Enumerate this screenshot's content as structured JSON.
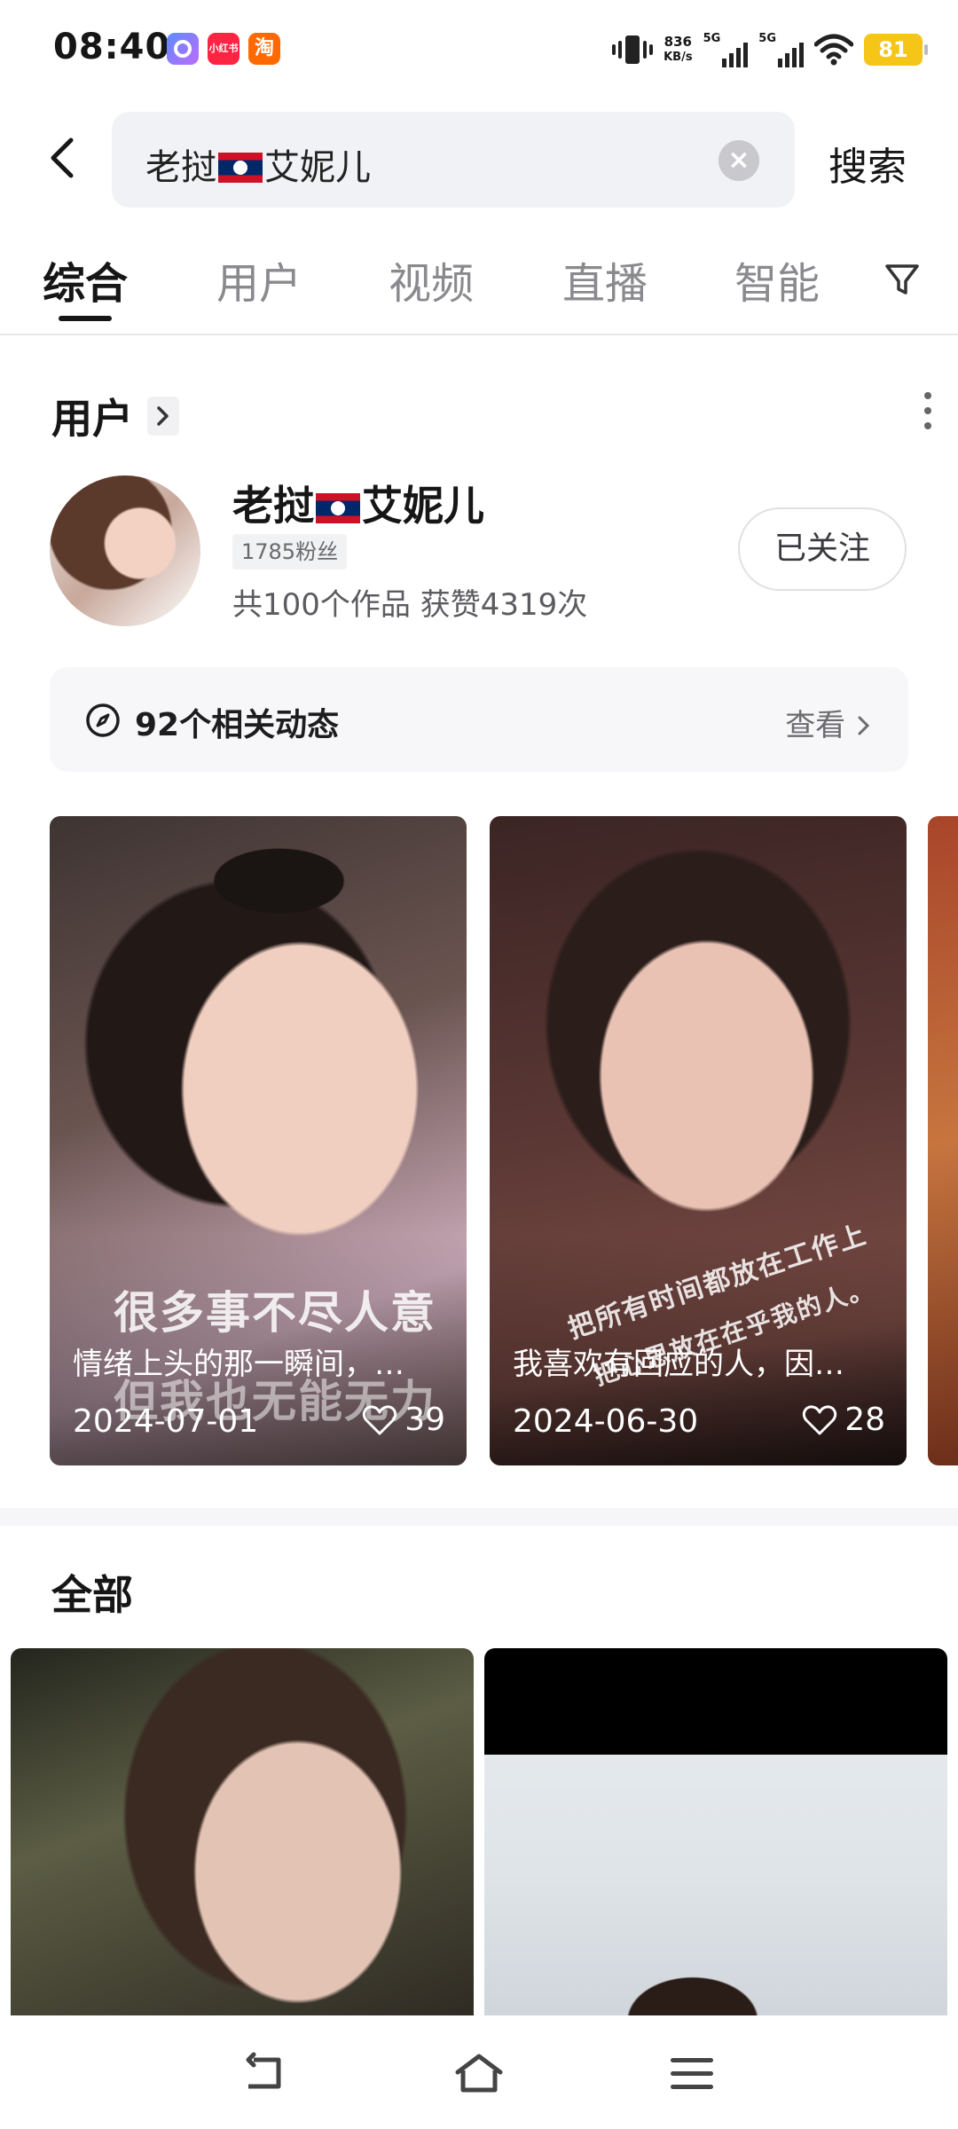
{
  "status_bar": {
    "time": "08:40",
    "apps": [
      "小红书",
      "淘"
    ],
    "net_speed_value": "836",
    "net_speed_unit": "KB/s",
    "signal1": "5G",
    "signal2": "5G",
    "battery": "81"
  },
  "search": {
    "query_prefix": "老挝",
    "query_suffix": "艾妮儿",
    "button": "搜索"
  },
  "tabs": [
    "综合",
    "用户",
    "视频",
    "直播",
    "智能"
  ],
  "user_section": {
    "title": "用户",
    "user": {
      "name_prefix": "老挝",
      "name_suffix": "艾妮儿",
      "fans": "1785粉丝",
      "stats": "共100个作品 获赞4319次",
      "follow_label": "已关注"
    },
    "related": {
      "text": "92个相关动态",
      "view": "查看"
    }
  },
  "videos": [
    {
      "overlay": "很多事不尽人意",
      "overlay2": "但我也无能无力",
      "title": "情绪上头的那一瞬间，…",
      "date": "2024-07-01",
      "likes": "39"
    },
    {
      "overlay": "把所有时间都放在工作上",
      "overlay2": "把心思放在在乎我的人。",
      "title": "我喜欢有回应的人，因…",
      "date": "2024-06-30",
      "likes": "28"
    }
  ],
  "all_section": {
    "title": "全部"
  },
  "colors": {
    "accent": "#161616",
    "battery": "#f5c518",
    "flag_red": "#ce1126",
    "flag_blue": "#002868"
  }
}
